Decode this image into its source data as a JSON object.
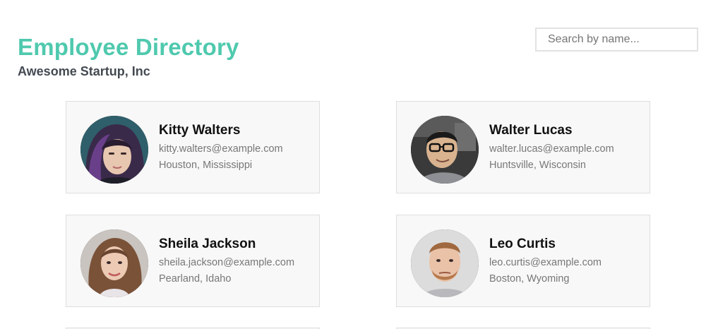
{
  "header": {
    "title": "Employee Directory",
    "subtitle": "Awesome Startup, Inc"
  },
  "search": {
    "placeholder": "Search by name...",
    "value": ""
  },
  "colors": {
    "accent": "#4fc9ae",
    "card_background": "#f8f8f8",
    "card_border": "#dedede"
  },
  "employees": [
    {
      "name": "Kitty Walters",
      "email": "kitty.walters@example.com",
      "location": "Houston, Mississippi"
    },
    {
      "name": "Walter Lucas",
      "email": "walter.lucas@example.com",
      "location": "Huntsville, Wisconsin"
    },
    {
      "name": "Sheila Jackson",
      "email": "sheila.jackson@example.com",
      "location": "Pearland, Idaho"
    },
    {
      "name": "Leo Curtis",
      "email": "leo.curtis@example.com",
      "location": "Boston, Wyoming"
    }
  ]
}
